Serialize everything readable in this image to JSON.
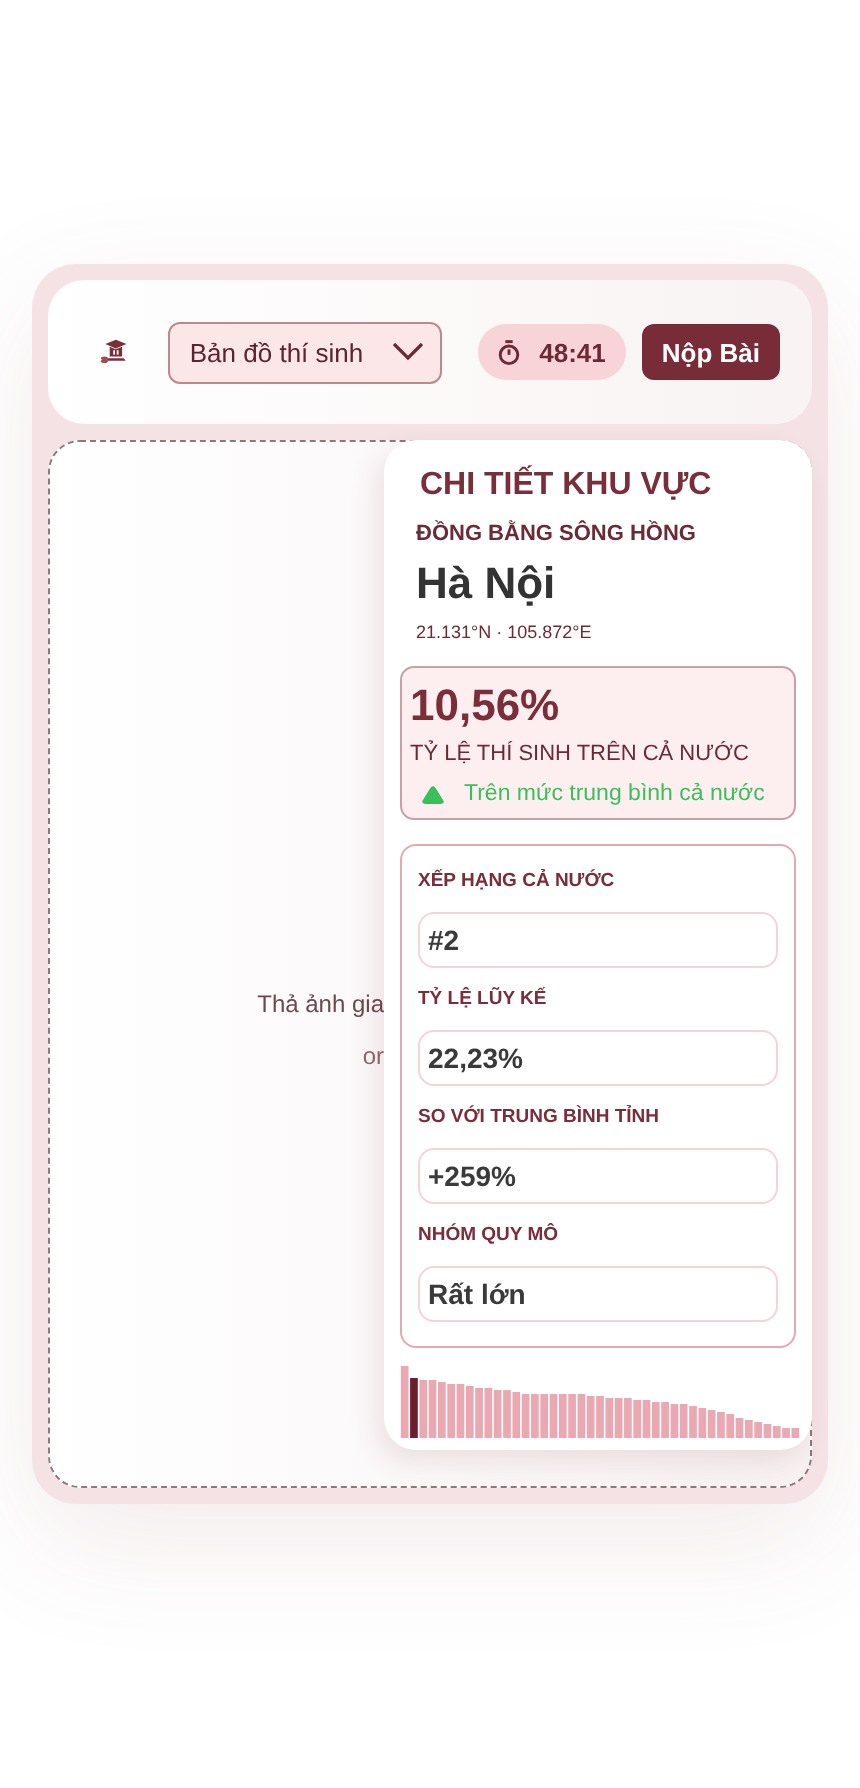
{
  "header": {
    "mode_select": {
      "value": "Bản đồ thí sinh"
    },
    "timer": {
      "value": "48:41"
    },
    "submit_button": {
      "label": "Nộp Bài"
    }
  },
  "drop_zone": {
    "lines": [
      "Thả ảnh gia",
      "or"
    ]
  },
  "detail_panel": {
    "title": "CHI TIẾT KHU VỰC",
    "region": "ĐỒNG BẰNG SÔNG HỒNG",
    "name": "Hà Nội",
    "coords": "21.131°N · 105.872°E",
    "stat": {
      "value": "10,56%",
      "label": "TỶ LỆ THÍ SINH TRÊN CẢ NƯỚC",
      "trend": {
        "kind": "up",
        "text": "Trên mức trung bình cả nước"
      }
    },
    "metrics": [
      {
        "label": "XẾP HẠNG CẢ NƯỚC",
        "value": "#2"
      },
      {
        "label": "TỶ LỆ LŨY KẾ",
        "value": "22,23%"
      },
      {
        "label": "SO VỚI TRUNG BÌNH TỈNH",
        "value": "+259%"
      },
      {
        "label": "NHÓM QUY MÔ",
        "value": "Rất lớn"
      }
    ]
  }
}
